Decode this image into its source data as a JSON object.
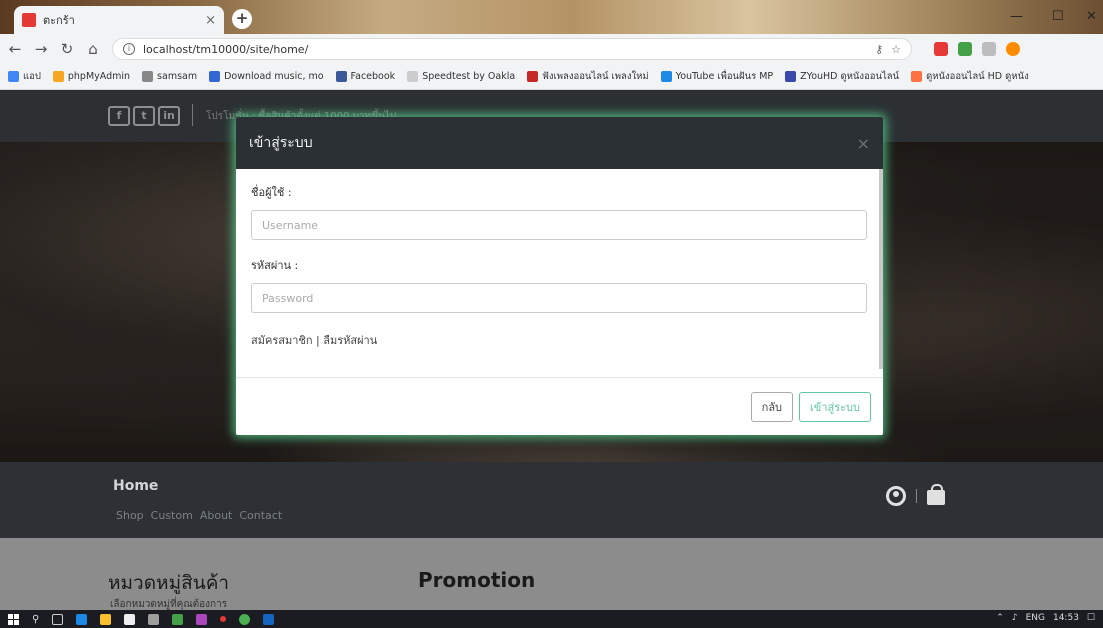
{
  "browser": {
    "tab_title": "ตะกร้า",
    "tab_close": "×",
    "new_tab": "+",
    "url": "localhost/tm10000/site/home/",
    "window_controls": [
      "—",
      "☐",
      "✕"
    ],
    "bookmarks": [
      {
        "label": "แอป",
        "color": "#4285f4"
      },
      {
        "label": "phpMyAdmin",
        "color": "#f5a623"
      },
      {
        "label": "samsam",
        "color": "#888888"
      },
      {
        "label": "Download music, mo",
        "color": "#3367d6"
      },
      {
        "label": "Facebook",
        "color": "#3b5998"
      },
      {
        "label": "Speedtest by Oakla",
        "color": "#cccccc"
      },
      {
        "label": "ฟังเพลงออนไลน์ เพลงใหม่",
        "color": "#c62828"
      },
      {
        "label": "YouTube เพื่อนฝันร MP",
        "color": "#1e88e5"
      },
      {
        "label": "ZYouHD ดูหนังออนไลน์",
        "color": "#3949ab"
      },
      {
        "label": "ดูหนังออนไลน์ HD ดูหนัง",
        "color": "#ff7043"
      }
    ]
  },
  "site": {
    "social_icons": [
      "f",
      "t",
      "in"
    ],
    "promo_text": "โปรโมชั่น : ซื้อสินค้าตั้งแต่ 1000 บาทขึ้นไป",
    "nav": {
      "home": "Home",
      "links": [
        "Shop",
        "Custom",
        "About",
        "Contact"
      ]
    },
    "category_title": "หมวดหมู่สินค้า",
    "category_subtitle": "เลือกหมวดหมู่ที่คุณต้องการ",
    "promotion_title": "Promotion"
  },
  "modal": {
    "title": "เข้าสู่ระบบ",
    "close": "×",
    "username_label": "ชื่อผู้ใช้ :",
    "username_placeholder": "Username",
    "password_label": "รหัสผ่าน :",
    "password_placeholder": "Password",
    "register_link": "สมัครสมาชิก",
    "link_separator": " | ",
    "forgot_link": "ลืมรหัสผ่าน",
    "back_button": "กลับ",
    "login_button": "เข้าสู่ระบบ",
    "accent_color": "#5fc6a0"
  },
  "taskbar": {
    "tray": [
      "ENG",
      "14:53"
    ]
  }
}
